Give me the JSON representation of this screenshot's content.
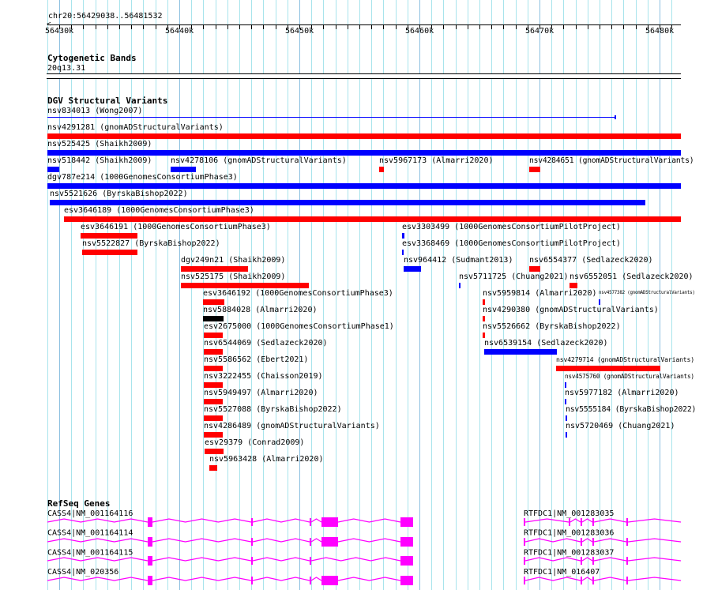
{
  "ruler": {
    "location": "chr20:56429038..56481532",
    "view_start_kb": 56429.0,
    "view_end_kb": 56481.8,
    "major_ticks": [
      {
        "kb": 56430,
        "label": "56430k"
      },
      {
        "kb": 56440,
        "label": "56440k"
      },
      {
        "kb": 56450,
        "label": "56450k"
      },
      {
        "kb": 56460,
        "label": "56460k"
      },
      {
        "kb": 56470,
        "label": "56470k"
      },
      {
        "kb": 56480,
        "label": "56480k"
      }
    ]
  },
  "cytobands": {
    "title": "Cytogenetic Bands",
    "band": "20q13.31"
  },
  "dgv": {
    "title": "DGV Structural Variants",
    "colors": {
      "red": "#ff0000",
      "blue": "#0000ff",
      "black": "#000000"
    },
    "rows": [
      [
        {
          "label": "nsv834013 (Wong2007)",
          "start": 56429.0,
          "end": 56476.25,
          "color": "blue",
          "thin": true
        }
      ],
      [
        {
          "label": "nsv4291281 (gnomADStructuralVariants)",
          "start": 56429.0,
          "end": 56481.8,
          "color": "red"
        }
      ],
      [
        {
          "label": "nsv525425 (Shaikh2009)",
          "start": 56429.0,
          "end": 56481.8,
          "color": "blue"
        }
      ],
      [
        {
          "label": "nsv518442 (Shaikh2009)",
          "start": 56429.0,
          "end": 56430.0,
          "color": "blue"
        },
        {
          "label": "nsv4278106 (gnomADStructuralVariants)",
          "start": 56439.3,
          "end": 56441.4,
          "color": "blue"
        },
        {
          "label": "nsv5967173 (Almarri2020)",
          "start": 56456.64,
          "end": 56457.04,
          "color": "red"
        },
        {
          "label": "nsv4284651 (gnomADStructuralVariants)",
          "start": 56469.14,
          "end": 56470.07,
          "color": "red"
        }
      ],
      [
        {
          "label": "dgv787e214 (1000GenomesConsortiumPhase3)",
          "start": 56429.0,
          "end": 56481.8,
          "color": "blue"
        }
      ],
      [
        {
          "label": "nsv5521626 (ByrskaBishop2022)",
          "start": 56429.2,
          "end": 56478.82,
          "color": "blue"
        }
      ],
      [
        {
          "label": "esv3646189 (1000GenomesConsortiumPhase3)",
          "start": 56430.4,
          "end": 56481.8,
          "color": "red"
        }
      ],
      [
        {
          "label": "esv3646191 (1000GenomesConsortiumPhase3)",
          "start": 56431.78,
          "end": 56436.51,
          "color": "red"
        },
        {
          "label": "esv3303499 (1000GenomesConsortiumPilotProject)",
          "start": 56458.55,
          "end": 56458.75,
          "color": "blue"
        }
      ],
      [
        {
          "label": "nsv5522827 (ByrskaBishop2022)",
          "start": 56431.91,
          "end": 56436.51,
          "color": "red"
        },
        {
          "label": "esv3368469 (1000GenomesConsortiumPilotProject)",
          "start": 56458.55,
          "end": 56458.7,
          "color": "blue"
        }
      ],
      [
        {
          "label": "dgv249n21 (Shaikh2009)",
          "start": 56440.13,
          "end": 56445.72,
          "color": "red"
        },
        {
          "label": "nsv964412 (Sudmant2013)",
          "start": 56458.68,
          "end": 56460.13,
          "color": "blue"
        },
        {
          "label": "nsv6554377 (Sedlazeck2020)",
          "start": 56469.14,
          "end": 56470.07,
          "color": "red"
        }
      ],
      [
        {
          "label": "nsv525175 (Shaikh2009)",
          "start": 56440.13,
          "end": 56450.79,
          "color": "red"
        },
        {
          "label": "nsv5711725 (Chuang2021)",
          "start": 56463.29,
          "end": 56463.42,
          "color": "blue"
        },
        {
          "label": "nsv6552051 (Sedlazeck2020)",
          "start": 56472.5,
          "end": 56473.16,
          "color": "red"
        }
      ],
      [
        {
          "label": "esv3646192 (1000GenomesConsortiumPhase3)",
          "start": 56441.97,
          "end": 56443.75,
          "color": "red"
        },
        {
          "label": "nsv5959814 (Almarri2020)",
          "start": 56465.26,
          "end": 56465.46,
          "color": "red"
        },
        {
          "label": "nsv4577382 (gnomADStructuralVariants)",
          "start": 56474.93,
          "end": 56475.07,
          "color": "blue"
        }
      ],
      [
        {
          "label": "nsv5884028 (Almarri2020)",
          "start": 56441.97,
          "end": 56443.68,
          "color": "black"
        },
        {
          "label": "nsv4290380 (gnomADStructuralVariants)",
          "start": 56465.26,
          "end": 56465.46,
          "color": "red"
        }
      ],
      [
        {
          "label": "esv2675000 (1000GenomesConsortiumPhase1)",
          "start": 56442.04,
          "end": 56443.62,
          "color": "red"
        },
        {
          "label": "nsv5526662 (ByrskaBishop2022)",
          "start": 56465.26,
          "end": 56465.46,
          "color": "red"
        }
      ],
      [
        {
          "label": "nsv6544069 (Sedlazeck2020)",
          "start": 56442.04,
          "end": 56443.62,
          "color": "red"
        },
        {
          "label": "nsv6539154 (Sedlazeck2020)",
          "start": 56465.39,
          "end": 56471.45,
          "color": "blue"
        }
      ],
      [
        {
          "label": "nsv5586562 (Ebert2021)",
          "start": 56442.04,
          "end": 56443.62,
          "color": "red"
        },
        {
          "label": "nsv4279714 (gnomADStructuralVariants)",
          "start": 56471.38,
          "end": 56480.07,
          "color": "red"
        }
      ],
      [
        {
          "label": "nsv3222455 (Chaisson2019)",
          "start": 56442.04,
          "end": 56443.62,
          "color": "red"
        },
        {
          "label": "nsv4575760 (gnomADStructuralVariants)",
          "start": 56472.11,
          "end": 56472.24,
          "color": "blue"
        }
      ],
      [
        {
          "label": "nsv5949497 (Almarri2020)",
          "start": 56442.04,
          "end": 56443.62,
          "color": "red"
        },
        {
          "label": "nsv5977182 (Almarri2020)",
          "start": 56472.11,
          "end": 56472.24,
          "color": "blue"
        }
      ],
      [
        {
          "label": "nsv5527088 (ByrskaBishop2022)",
          "start": 56442.04,
          "end": 56443.62,
          "color": "red"
        },
        {
          "label": "nsv5555184 (ByrskaBishop2022)",
          "start": 56472.17,
          "end": 56472.3,
          "color": "blue"
        }
      ],
      [
        {
          "label": "nsv4286489 (gnomADStructuralVariants)",
          "start": 56442.04,
          "end": 56443.62,
          "color": "red"
        },
        {
          "label": "nsv5720469 (Chuang2021)",
          "start": 56472.17,
          "end": 56472.3,
          "color": "blue"
        }
      ],
      [
        {
          "label": "esv29379 (Conrad2009)",
          "start": 56442.1,
          "end": 56443.68,
          "color": "red"
        }
      ],
      [
        {
          "label": "nsv5963428 (Almarri2020)",
          "start": 56442.5,
          "end": 56443.16,
          "color": "red"
        }
      ]
    ]
  },
  "refseq": {
    "title": "RefSeq Genes",
    "color": "#ff00ff",
    "rows": [
      [
        {
          "label": "CASS4|NM_001164116",
          "start": 56429.0,
          "end": 56459.47,
          "exons": [
            [
              56437.37,
              56437.76
            ],
            [
              56445.99,
              56446.12
            ],
            [
              56450.86,
              56450.99
            ],
            [
              56451.84,
              56453.22
            ],
            [
              56458.42,
              56459.47
            ]
          ]
        },
        {
          "label": "RTFDC1|NM_001283035",
          "start": 56468.68,
          "end": 56481.8,
          "exons": [
            [
              56468.68,
              56468.81
            ],
            [
              56472.43,
              56472.56
            ],
            [
              56473.42,
              56473.55
            ],
            [
              56474.41,
              56474.54
            ],
            [
              56477.24,
              56477.37
            ]
          ]
        }
      ],
      [
        {
          "label": "CASS4|NM_001164114",
          "start": 56429.0,
          "end": 56459.47,
          "exons": [
            [
              56437.37,
              56437.76
            ],
            [
              56445.99,
              56446.12
            ],
            [
              56450.86,
              56450.99
            ],
            [
              56451.84,
              56453.22
            ],
            [
              56458.42,
              56459.47
            ]
          ]
        },
        {
          "label": "RTFDC1|NM_001283036",
          "start": 56468.68,
          "end": 56481.8,
          "exons": [
            [
              56468.68,
              56468.81
            ],
            [
              56473.42,
              56473.55
            ],
            [
              56474.41,
              56474.54
            ],
            [
              56477.24,
              56477.37
            ]
          ]
        }
      ],
      [
        {
          "label": "CASS4|NM_001164115",
          "start": 56429.0,
          "end": 56459.47,
          "exons": [
            [
              56437.37,
              56437.76
            ],
            [
              56445.99,
              56446.12
            ],
            [
              56450.86,
              56450.99
            ],
            [
              56458.42,
              56459.47
            ]
          ]
        },
        {
          "label": "RTFDC1|NM_001283037",
          "start": 56468.68,
          "end": 56481.8,
          "exons": [
            [
              56468.68,
              56468.81
            ],
            [
              56473.42,
              56473.55
            ],
            [
              56474.41,
              56474.54
            ],
            [
              56477.24,
              56477.37
            ]
          ]
        }
      ],
      [
        {
          "label": "CASS4|NM_020356",
          "start": 56429.0,
          "end": 56459.47,
          "exons": [
            [
              56437.37,
              56437.76
            ],
            [
              56445.99,
              56446.12
            ],
            [
              56450.86,
              56450.99
            ],
            [
              56451.84,
              56453.22
            ],
            [
              56458.42,
              56459.47
            ]
          ]
        },
        {
          "label": "RTFDC1|NM_016407",
          "start": 56468.68,
          "end": 56481.8,
          "exons": [
            [
              56468.68,
              56468.81
            ],
            [
              56473.42,
              56473.55
            ],
            [
              56474.41,
              56474.54
            ],
            [
              56477.24,
              56477.37
            ]
          ]
        }
      ]
    ]
  }
}
